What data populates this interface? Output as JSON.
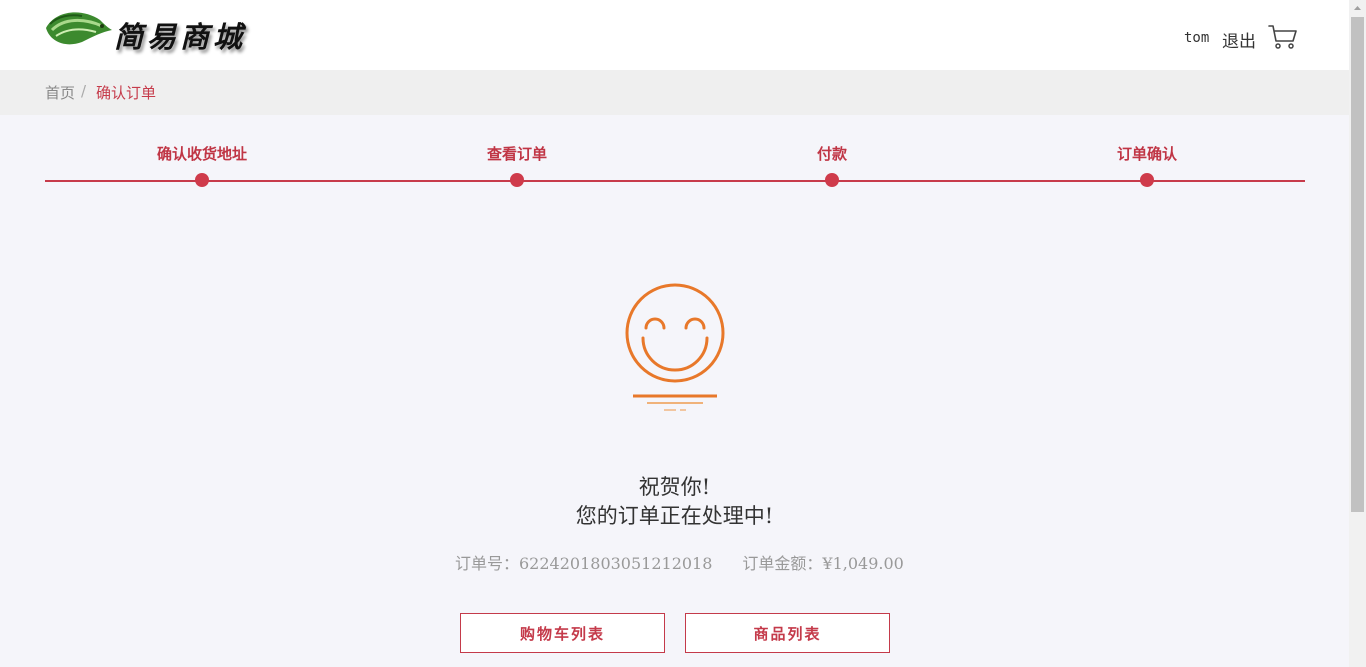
{
  "header": {
    "logo_text": "简易商城",
    "username": "tom",
    "logout_label": "退出",
    "cart_icon": "shopping-cart-icon"
  },
  "breadcrumb": {
    "home": "首页",
    "separator": "/",
    "current": "确认订单"
  },
  "steps": [
    {
      "label": "确认收货地址"
    },
    {
      "label": "查看订单"
    },
    {
      "label": "付款"
    },
    {
      "label": "订单确认"
    }
  ],
  "result": {
    "icon": "smiley-icon",
    "title": "祝贺你!",
    "subtitle": "您的订单正在处理中!",
    "order_no": "订单号：6224201803051212018",
    "order_amount": "订单金额：¥1,049.00"
  },
  "actions": {
    "cart_list_label": "购物车列表",
    "product_list_label": "商品列表"
  },
  "colors": {
    "accent": "#c73b4b",
    "smiley": "#e8782a",
    "background": "#f5f5fa"
  }
}
